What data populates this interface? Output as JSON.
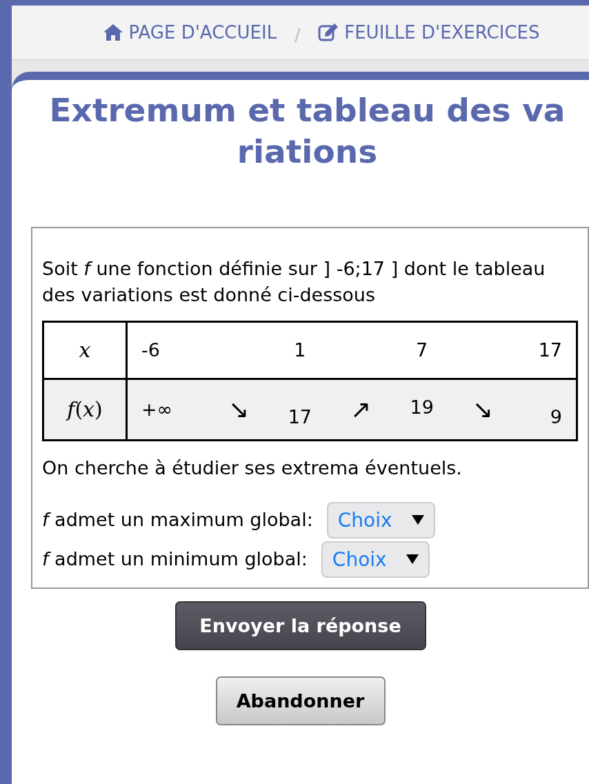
{
  "breadcrumb": [
    {
      "kind": "home",
      "label": "PAGE D'ACCUEIL"
    },
    {
      "kind": "sheet",
      "label": "FEUILLE D'EXERCICES"
    }
  ],
  "breadcrumb_separator": "/",
  "title_lines": [
    "Extremum et tableau des va",
    "riations"
  ],
  "intro": "Soit *f* une fonction définie sur ] -6;17 ] dont le tableau des variations est donné ci-dessous",
  "table": {
    "x_row": {
      "label": "x",
      "values": [
        "-6",
        "1",
        "7",
        "17"
      ]
    },
    "f_row": {
      "label": "*f*(*x*)",
      "items": [
        {
          "kind": "value",
          "text": "+∞"
        },
        {
          "kind": "arrow",
          "text": "↘"
        },
        {
          "kind": "value",
          "text": "17"
        },
        {
          "kind": "arrow",
          "text": "↗"
        },
        {
          "kind": "value",
          "text": "19"
        },
        {
          "kind": "arrow",
          "text": "↘"
        },
        {
          "kind": "value",
          "text": "9"
        }
      ]
    }
  },
  "question": "On cherche à étudier ses extrema éventuels.",
  "answers": [
    {
      "label": "*f* admet un maximum global:",
      "select": "Choix"
    },
    {
      "label": "*f* admet un minimum global:",
      "select": "Choix"
    }
  ],
  "buttons": [
    {
      "kind": "primary",
      "label": "Envoyer la réponse"
    },
    {
      "kind": "secondary",
      "label": "Abandonner"
    }
  ]
}
